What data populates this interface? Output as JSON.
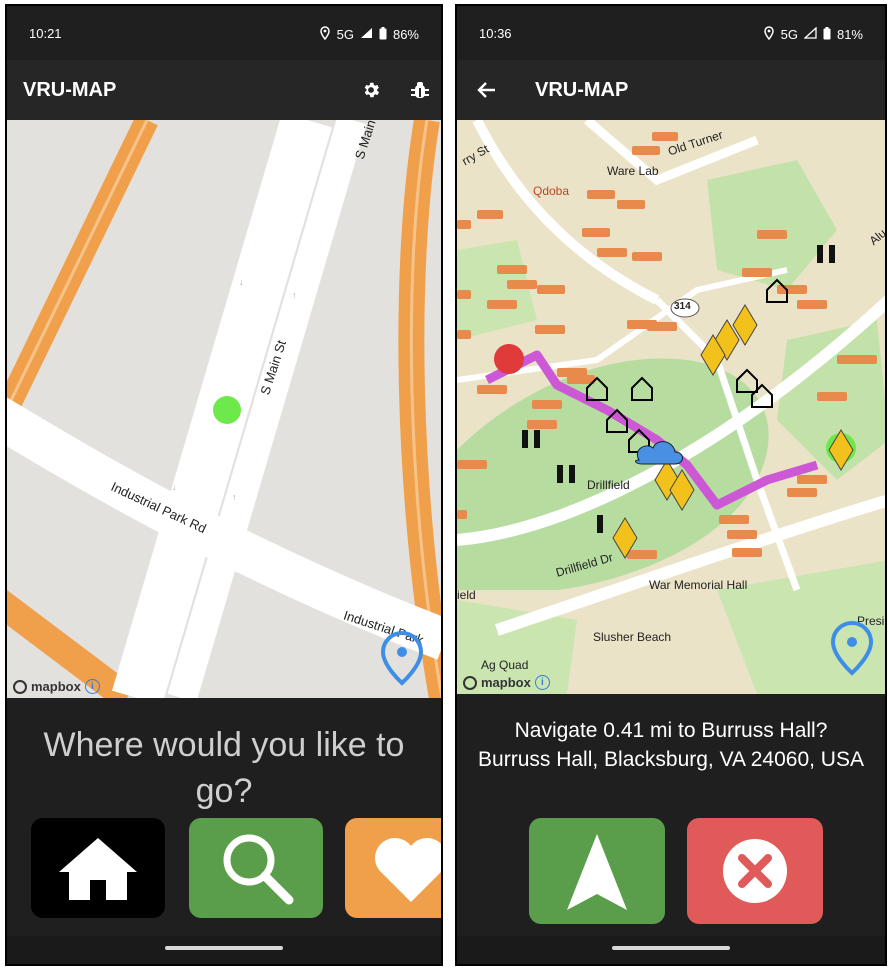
{
  "screens": [
    {
      "status": {
        "time": "10:21",
        "network": "5G",
        "battery": "86%"
      },
      "appbar": {
        "title": "VRU-MAP",
        "icons": [
          "settings-gear-icon",
          "bug-icon"
        ]
      },
      "map": {
        "street_labels": [
          "S Main",
          "S Main St",
          "Industrial Park Rd",
          "Industrial Park"
        ],
        "attribution": "mapbox"
      },
      "prompt": "Where would you like to go?",
      "buttons": [
        {
          "name": "home",
          "icon": "home-icon",
          "color": "#000000"
        },
        {
          "name": "search",
          "icon": "search-icon",
          "color": "#5a9e4b"
        },
        {
          "name": "favorites",
          "icon": "heart-icon",
          "color": "#f0a04b"
        }
      ]
    },
    {
      "status": {
        "time": "10:36",
        "network": "5G",
        "battery": "81%"
      },
      "appbar": {
        "title": "VRU-MAP",
        "icons": [
          "back-arrow-icon"
        ]
      },
      "map": {
        "place_labels": [
          "Ware Lab",
          "Qdoba",
          "Old Turner",
          "Drillfield",
          "Drillfield Dr",
          "War Memorial Hall",
          "Slusher Beach",
          "Ag Quad",
          "Presi",
          "Alu",
          "rry St",
          "ield"
        ],
        "road_shield": "314",
        "attribution": "mapbox"
      },
      "prompt": {
        "line1": "Navigate 0.41 mi to Burruss Hall?",
        "line2": "Burruss Hall, Blacksburg, VA 24060, USA"
      },
      "buttons": [
        {
          "name": "start-navigation",
          "icon": "navigation-arrow-icon",
          "color": "#5a9e4b"
        },
        {
          "name": "cancel",
          "icon": "close-x-icon",
          "color": "#e15a5a"
        }
      ]
    }
  ]
}
